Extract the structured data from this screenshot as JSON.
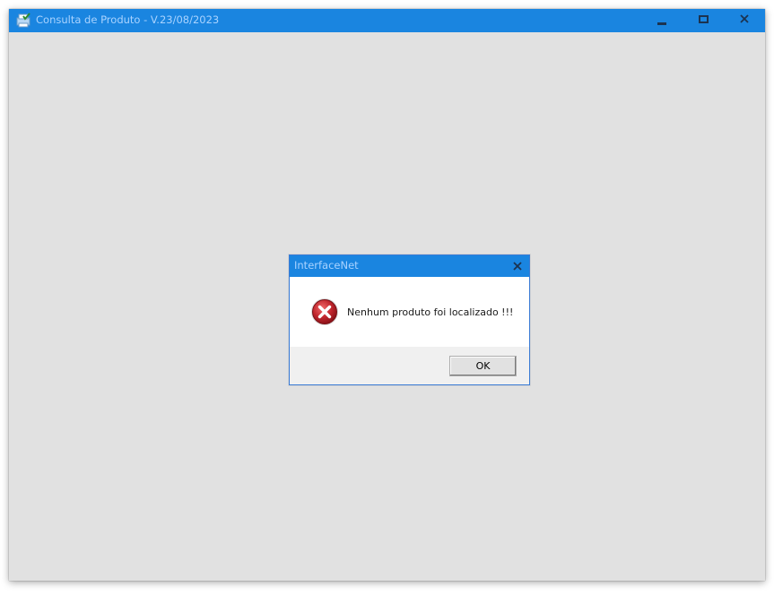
{
  "main_window": {
    "title": "Consulta de Produto - V.23/08/2023",
    "icon": "app-printer-check-icon",
    "controls": {
      "minimize": "minimize-icon",
      "maximize": "maximize-icon",
      "close": "close-icon"
    }
  },
  "dialog": {
    "title": "InterfaceNet",
    "close_icon": "close-icon",
    "icon": "error-icon",
    "message": "Nenhum produto foi localizado !!!",
    "ok_label": "OK"
  },
  "colors": {
    "titlebar": "#1a85e0",
    "title_text": "#a9d3ff",
    "window_background": "#e1e1e1",
    "error_red": "#c0262d"
  }
}
